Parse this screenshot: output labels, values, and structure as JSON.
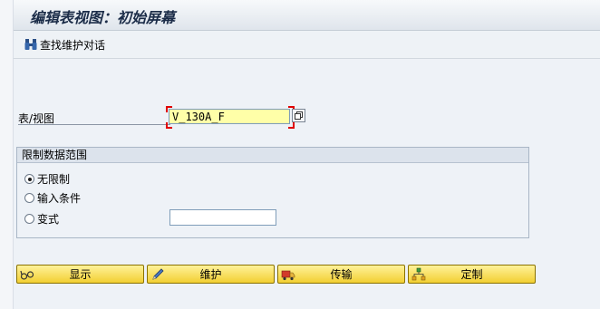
{
  "window": {
    "title": "编辑表视图：初始屏幕"
  },
  "toolbar": {
    "find_dialog_label": "查找维护对话"
  },
  "form": {
    "table_view_label": "表/视图",
    "table_view_value": "V_130A_F"
  },
  "restrict": {
    "group_title": "限制数据范围",
    "options": [
      {
        "label": "无限制",
        "selected": true
      },
      {
        "label": "输入条件",
        "selected": false
      },
      {
        "label": "变式",
        "selected": false
      }
    ],
    "variant_value": ""
  },
  "actions": [
    {
      "label": "显示",
      "icon": "glasses-icon"
    },
    {
      "label": "维护",
      "icon": "pencil-icon"
    },
    {
      "label": "传输",
      "icon": "truck-icon"
    },
    {
      "label": "定制",
      "icon": "hierarchy-icon"
    }
  ],
  "colors": {
    "button_yellow": "#f2cf32",
    "required_marker": "#e00000",
    "input_yellow": "#ffffa8"
  }
}
